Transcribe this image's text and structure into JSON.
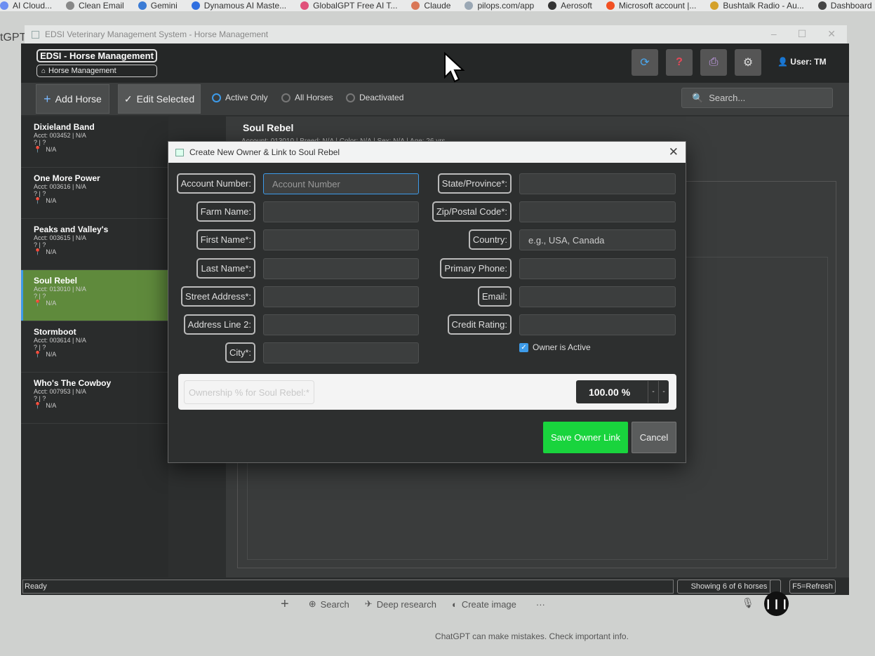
{
  "bookmarks": [
    {
      "label": "AI Cloud...",
      "color": "#6c8ef2"
    },
    {
      "label": "Clean Email",
      "color": "#888888"
    },
    {
      "label": "Gemini",
      "color": "#3a7bd5"
    },
    {
      "label": "Dynamous AI Maste...",
      "color": "#2f6fe0"
    },
    {
      "label": "GlobalGPT Free AI T...",
      "color": "#e0507a"
    },
    {
      "label": "Claude",
      "color": "#d97757"
    },
    {
      "label": "pilops.com/app",
      "color": "#9aa7b4"
    },
    {
      "label": "Aerosoft",
      "color": "#333333"
    },
    {
      "label": "Microsoft account |...",
      "color": "#f25022"
    },
    {
      "label": "Bushtalk Radio - Au...",
      "color": "#d4a12a"
    },
    {
      "label": "Dashboard :: Nurp",
      "color": "#444444"
    }
  ],
  "left_cut_text": "tGPT",
  "window": {
    "title": "EDSI Veterinary Management System - Horse Management",
    "controls": [
      "–",
      "☐",
      "✕"
    ]
  },
  "header": {
    "brand": "EDSI - Horse Management",
    "breadcrumb": "Horse Management",
    "icons": [
      "refresh-icon",
      "help-icon",
      "print-icon",
      "settings-icon"
    ],
    "user": "User: TM"
  },
  "toolbar": {
    "add_label": "Add Horse",
    "edit_label": "Edit Selected",
    "filters": [
      {
        "label": "Active Only",
        "selected": true
      },
      {
        "label": "All Horses",
        "selected": false
      },
      {
        "label": "Deactivated",
        "selected": false
      }
    ],
    "search_placeholder": "Search..."
  },
  "horses": [
    {
      "name": "Dixieland Band",
      "acct": "Acct: 003452 | N/A",
      "q": "? | ?",
      "na": "N/A",
      "selected": false
    },
    {
      "name": "One More Power",
      "acct": "Acct: 003616 | N/A",
      "q": "? | ?",
      "na": "N/A",
      "selected": false
    },
    {
      "name": "Peaks and Valley's",
      "acct": "Acct: 003615 | N/A",
      "q": "? | ?",
      "na": "N/A",
      "selected": false
    },
    {
      "name": "Soul Rebel",
      "acct": "Acct: 013010 | N/A",
      "q": "? | ?",
      "na": "N/A",
      "selected": true
    },
    {
      "name": "Stormboot",
      "acct": "Acct: 003614 | N/A",
      "q": "? | ?",
      "na": "N/A",
      "selected": false
    },
    {
      "name": "Who's The Cowboy",
      "acct": "Acct: 007953 | N/A",
      "q": "? | ?",
      "na": "N/A",
      "selected": false
    }
  ],
  "detail": {
    "name": "Soul Rebel",
    "subtitle": "Account: 013010 | Breed: N/A | Color: N/A | Sex: N/A | Age: 26 yrs"
  },
  "modal": {
    "title": "Create New Owner & Link to Soul Rebel",
    "left_fields": [
      {
        "label": "Account Number:",
        "value": "",
        "placeholder": "Account Number"
      },
      {
        "label": "Farm Name:",
        "value": "",
        "placeholder": ""
      },
      {
        "label": "First Name*:",
        "value": "",
        "placeholder": ""
      },
      {
        "label": "Last Name*:",
        "value": "",
        "placeholder": ""
      },
      {
        "label": "Street Address*:",
        "value": "",
        "placeholder": ""
      },
      {
        "label": "Address Line 2:",
        "value": "",
        "placeholder": ""
      },
      {
        "label": "City*:",
        "value": "",
        "placeholder": ""
      }
    ],
    "right_fields": [
      {
        "label": "State/Province*:",
        "value": "",
        "placeholder": ""
      },
      {
        "label": "Zip/Postal Code*:",
        "value": "",
        "placeholder": ""
      },
      {
        "label": "Country:",
        "value": "",
        "placeholder": "e.g., USA, Canada"
      },
      {
        "label": "Primary Phone:",
        "value": "",
        "placeholder": ""
      },
      {
        "label": "Email:",
        "value": "",
        "placeholder": ""
      },
      {
        "label": "Credit Rating:",
        "value": "",
        "placeholder": ""
      }
    ],
    "active_label": "Owner is Active",
    "active_checked": true,
    "ownership_label": "Ownership % for Soul Rebel:*",
    "ownership_value": "100.00 %",
    "save_label": "Save Owner Link",
    "cancel_label": "Cancel"
  },
  "statusbar": {
    "status": "Ready",
    "count": "Showing 6 of 6 horses",
    "refresh": "F5=Refresh"
  },
  "chatgpt": {
    "actions": [
      {
        "icon": "plus-icon",
        "label": ""
      },
      {
        "icon": "globe-icon",
        "label": "Search"
      },
      {
        "icon": "telescope-icon",
        "label": "Deep research"
      },
      {
        "icon": "palette-icon",
        "label": "Create image"
      },
      {
        "icon": "more-icon",
        "label": "···"
      }
    ],
    "disclaimer": "ChatGPT can make mistakes. Check important info."
  },
  "colors": {
    "accent_blue": "#3d9be9",
    "save_green": "#19d43d",
    "selected_row": "#5f8a3c",
    "app_bg": "#2d2f2f"
  }
}
